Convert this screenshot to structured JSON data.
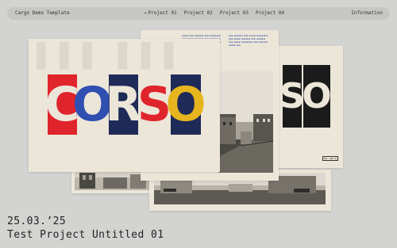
{
  "nav": {
    "site_title": "Cargo Demo Template",
    "active_arrow": "→",
    "projects": [
      "Project 01",
      "Project 02",
      "Project 03",
      "Project 04"
    ],
    "information": "Information"
  },
  "cover": {
    "letters": [
      "C",
      "O",
      "R",
      "S",
      "O"
    ],
    "colors": {
      "red": "#e0242c",
      "blue": "#2f4fb1",
      "navy": "#1e2a57",
      "yellow": "#e6b51e",
      "paper": "#ece6d9"
    }
  },
  "right_card": {
    "letters": [
      "S",
      "O"
    ],
    "stamp": "SEL·ART·E"
  },
  "footer": {
    "date": "25.03.’25",
    "title": "Test Project Untitled 01"
  }
}
